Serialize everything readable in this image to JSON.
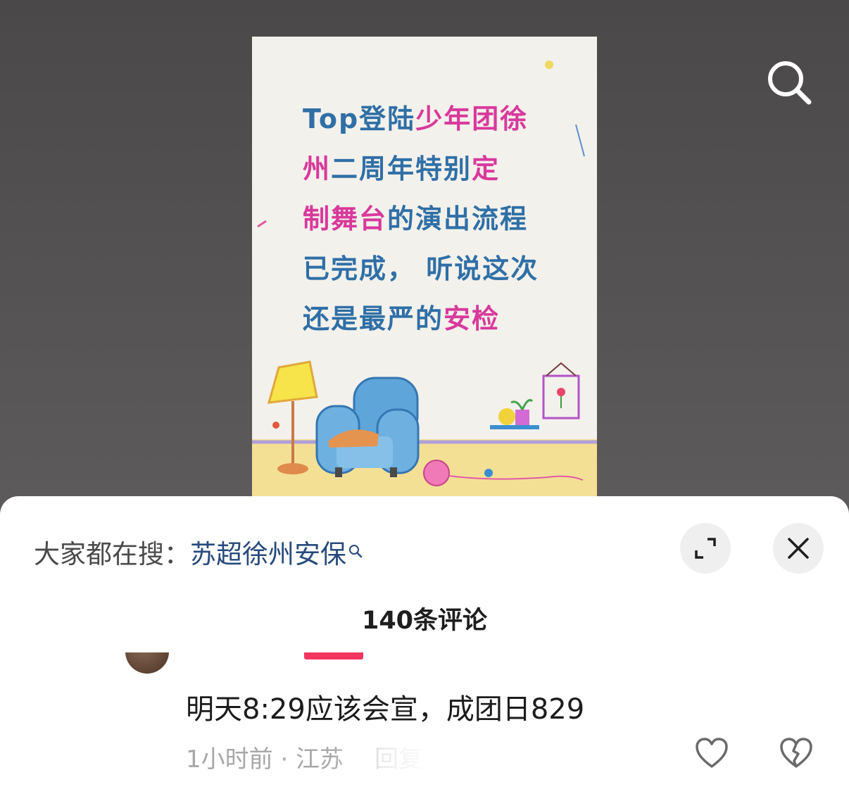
{
  "poster": {
    "lines": [
      {
        "blue": "Top登陆",
        "pink": "少年团徐"
      },
      {
        "pink": "州",
        "blue": "二周年特别",
        "pink2": "定"
      },
      {
        "pink": "制舞台",
        "blue": "的演出流程"
      },
      {
        "blue": "已完成，  听说这次"
      },
      {
        "blue": "还是最严的",
        "pink": "安检"
      }
    ]
  },
  "top_bar": {
    "search_icon": "search-icon"
  },
  "sheet": {
    "hot_search_prefix": "大家都在搜：",
    "hot_search_keyword": "苏超徐州安保",
    "expand_icon": "expand-icon",
    "close_icon": "close-icon",
    "comment_count": "140条评论"
  },
  "comment": {
    "text": "明天8:29应该会宣，成团日829",
    "time_location": "1小时前 · 江苏",
    "reply_label": "回复",
    "like_icon": "heart-icon",
    "dislike_icon": "broken-heart-icon"
  },
  "colors": {
    "poster_blue": "#2f6fa6",
    "poster_pink": "#d8399b",
    "keyword_blue": "#274a7c",
    "badge_red": "#f2365f"
  }
}
